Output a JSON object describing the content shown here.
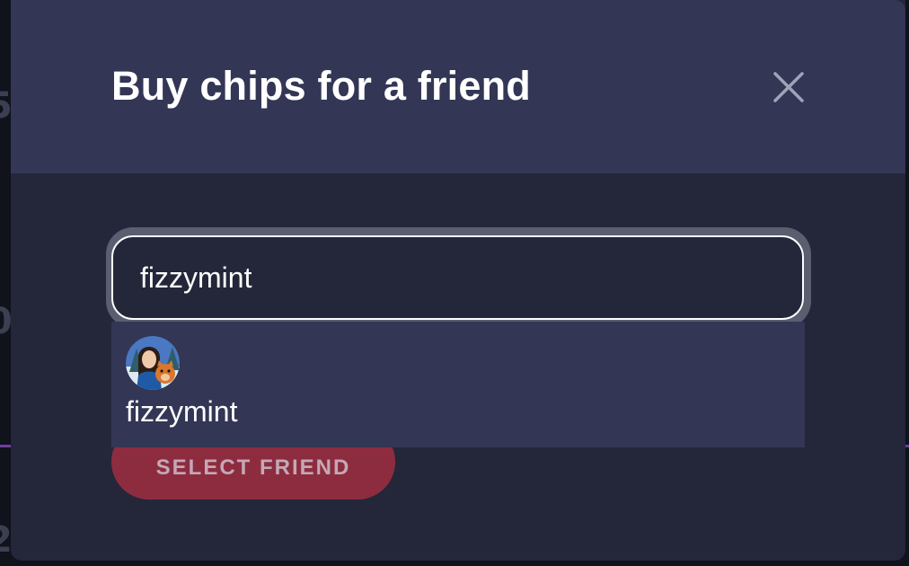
{
  "dialog": {
    "title": "Buy chips for a friend",
    "close_icon": "close-icon"
  },
  "search": {
    "value": "fizzymint",
    "placeholder": ""
  },
  "suggestions": [
    {
      "username": "fizzymint",
      "avatar_icon": "avatar-image"
    }
  ],
  "actions": {
    "select_friend_label": "SELECT FRIEND"
  },
  "colors": {
    "header_bg": "#333655",
    "body_bg": "#24273a",
    "primary_button": "#8e2c3f",
    "primary_button_text": "#c4a8b6",
    "dropdown_bg": "#333655",
    "input_border": "#ffffff"
  }
}
